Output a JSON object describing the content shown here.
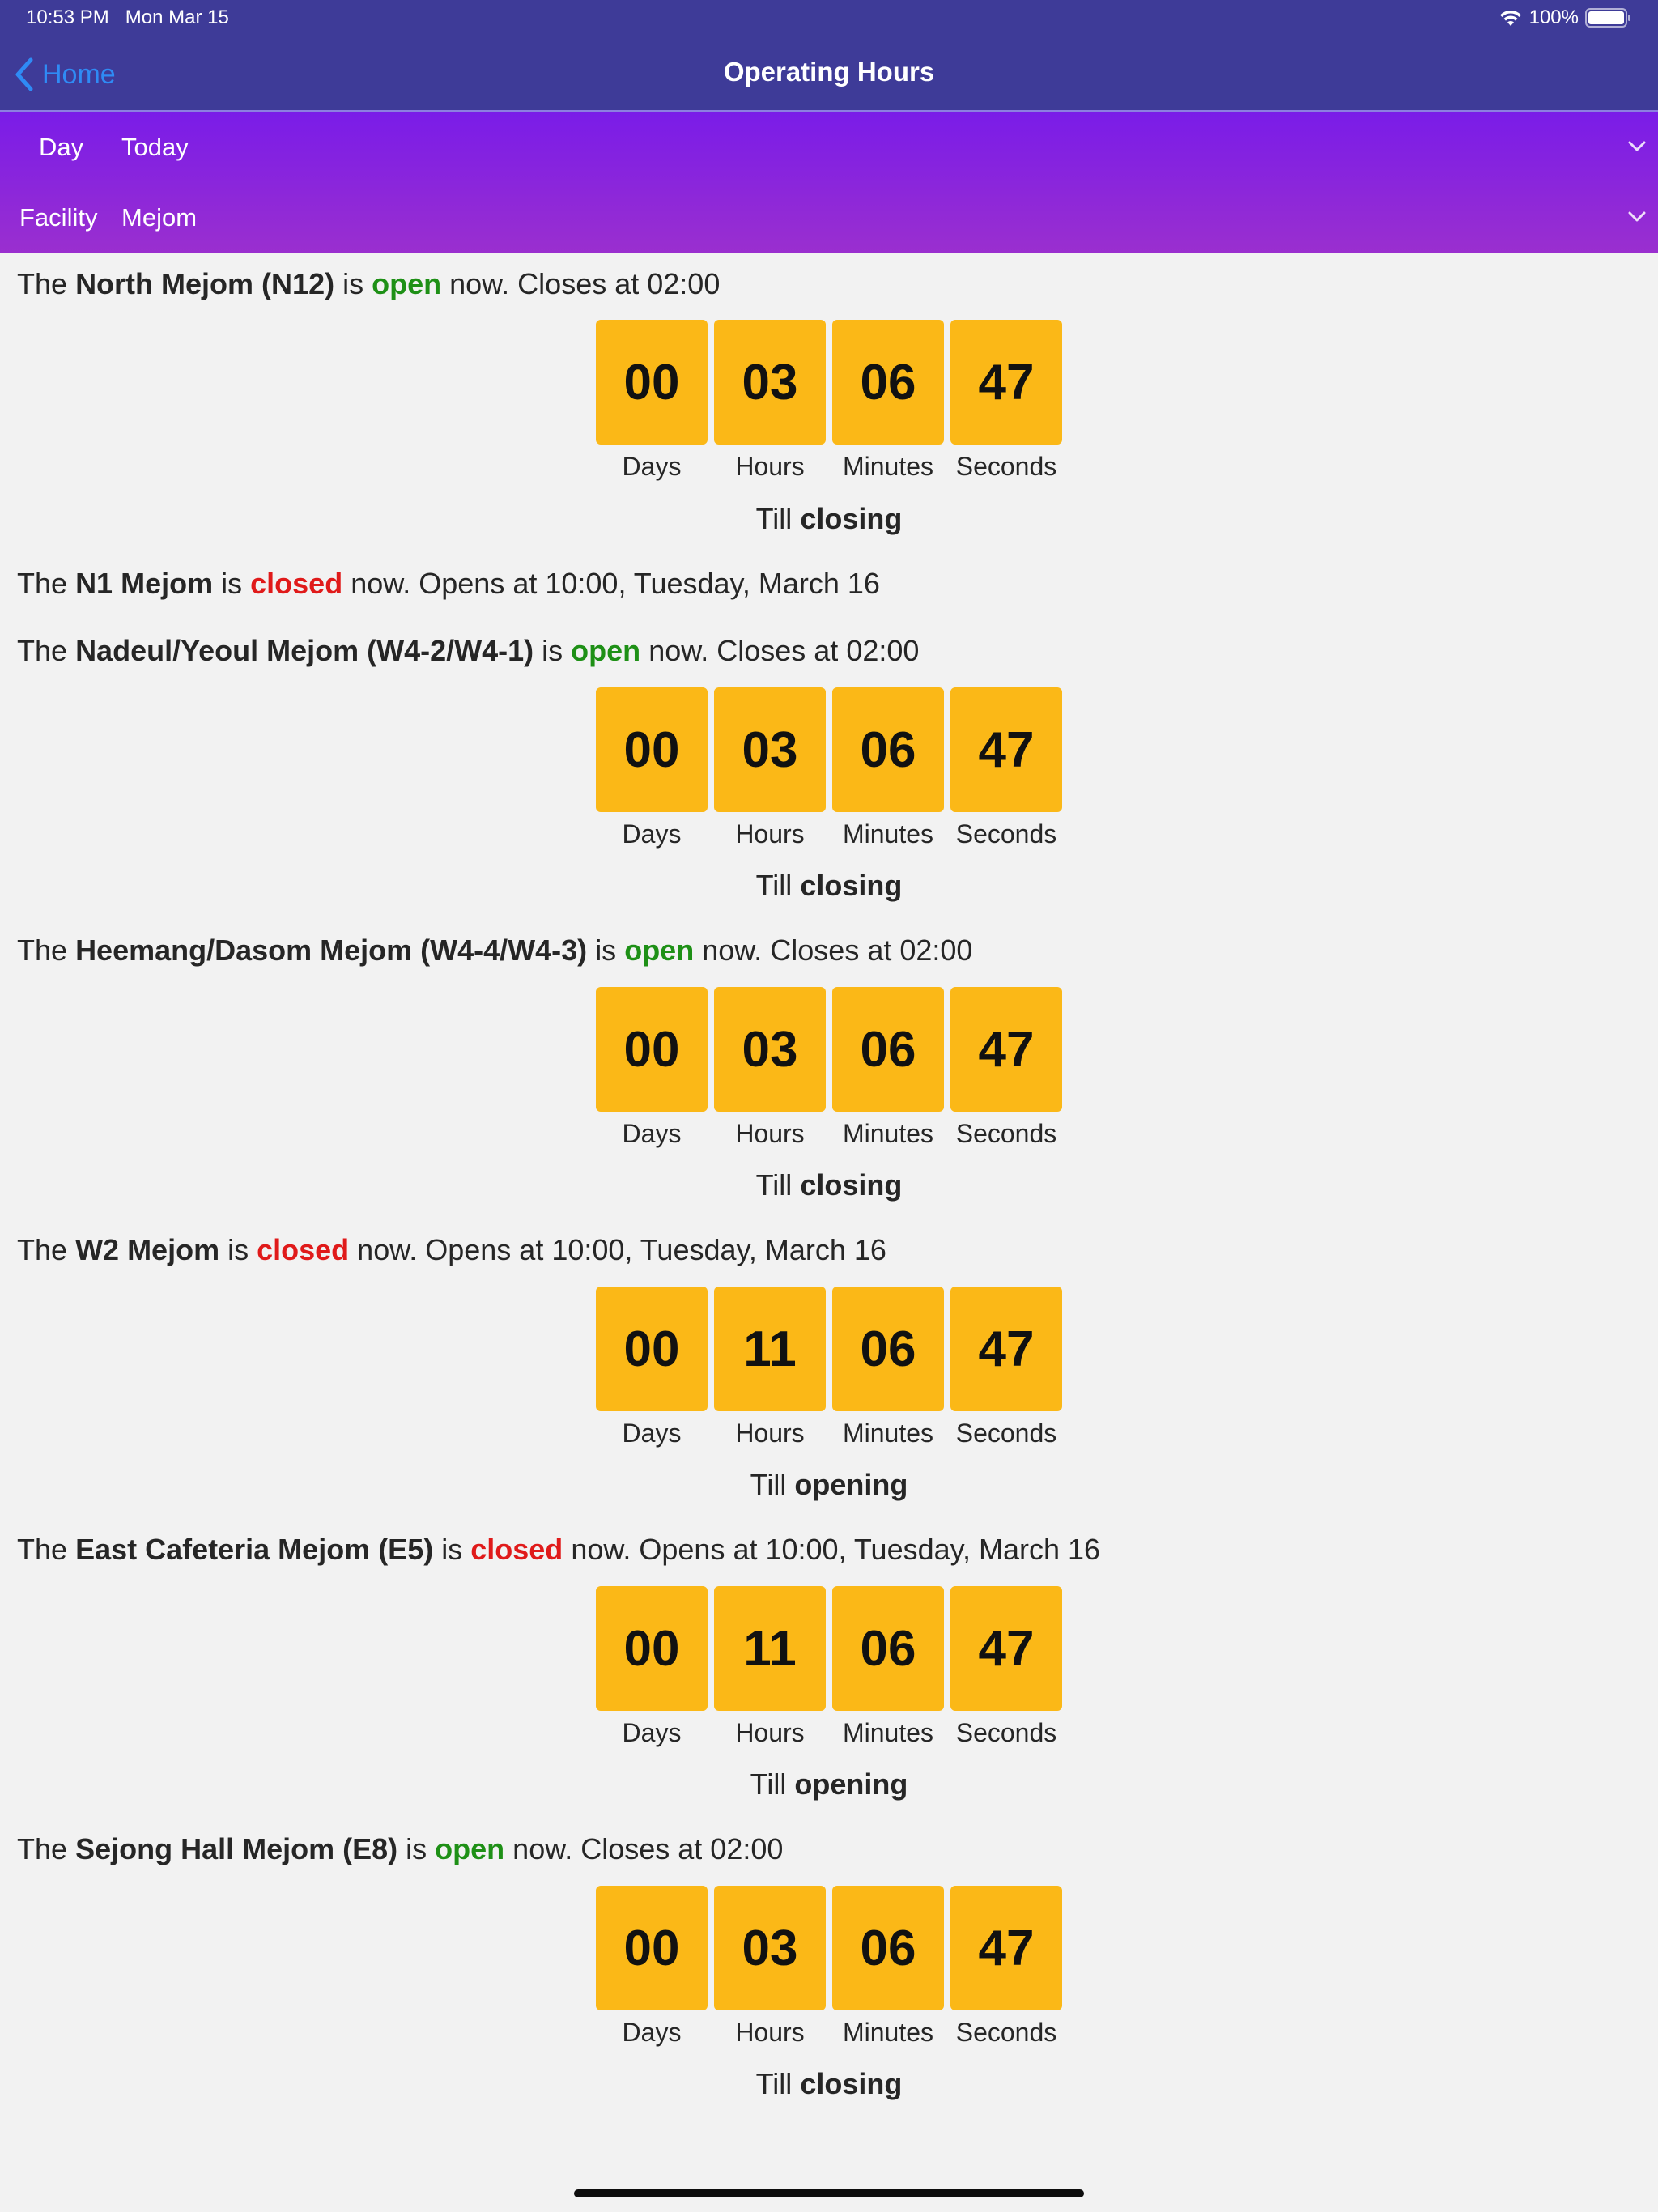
{
  "status_bar": {
    "time": "10:53 PM",
    "date": "Mon Mar 15",
    "battery": "100%",
    "wifi_icon": "wifi-icon",
    "battery_icon": "battery-icon"
  },
  "nav": {
    "back_label": "Home",
    "title": "Operating Hours",
    "back_icon": "chevron-left-icon"
  },
  "colors": {
    "nav_bg": "#3e3b98",
    "filter_gradient_start": "#7a1ce8",
    "filter_gradient_end": "#9a2fcf",
    "accent": "#2f8bf5",
    "open": "#1e9016",
    "closed": "#e01a1a",
    "countdown_box": "#fbb817"
  },
  "filters": {
    "day": {
      "label": "Day",
      "value": "Today"
    },
    "facility": {
      "label": "Facility",
      "value": "Mejom"
    }
  },
  "labels": {
    "days": "Days",
    "hours": "Hours",
    "minutes": "Minutes",
    "seconds": "Seconds",
    "till": "Till"
  },
  "facilities": [
    {
      "prefix": "The",
      "name": "North Mejom (N12)",
      "is": "is",
      "status": "open",
      "suffix": "now. Closes at 02:00",
      "countdown": {
        "days": "00",
        "hours": "03",
        "minutes": "06",
        "seconds": "47"
      },
      "till": "closing"
    },
    {
      "prefix": "The",
      "name": "N1 Mejom",
      "is": "is",
      "status": "closed",
      "suffix": "now. Opens at 10:00, Tuesday, March 16"
    },
    {
      "prefix": "The",
      "name": "Nadeul/Yeoul Mejom (W4-2/W4-1)",
      "is": "is",
      "status": "open",
      "suffix": "now. Closes at 02:00",
      "countdown": {
        "days": "00",
        "hours": "03",
        "minutes": "06",
        "seconds": "47"
      },
      "till": "closing"
    },
    {
      "prefix": "The",
      "name": "Heemang/Dasom Mejom (W4-4/W4-3)",
      "is": "is",
      "status": "open",
      "suffix": "now. Closes at 02:00",
      "countdown": {
        "days": "00",
        "hours": "03",
        "minutes": "06",
        "seconds": "47"
      },
      "till": "closing"
    },
    {
      "prefix": "The",
      "name": "W2 Mejom",
      "is": "is",
      "status": "closed",
      "suffix": "now. Opens at 10:00, Tuesday, March 16",
      "countdown": {
        "days": "00",
        "hours": "11",
        "minutes": "06",
        "seconds": "47"
      },
      "till": "opening"
    },
    {
      "prefix": "The",
      "name": "East Cafeteria Mejom (E5)",
      "is": "is",
      "status": "closed",
      "suffix": "now. Opens at 10:00, Tuesday, March 16",
      "countdown": {
        "days": "00",
        "hours": "11",
        "minutes": "06",
        "seconds": "47"
      },
      "till": "opening"
    },
    {
      "prefix": "The",
      "name": "Sejong Hall Mejom (E8)",
      "is": "is",
      "status": "open",
      "suffix": "now. Closes at 02:00",
      "countdown": {
        "days": "00",
        "hours": "03",
        "minutes": "06",
        "seconds": "47"
      },
      "till": "closing"
    }
  ]
}
